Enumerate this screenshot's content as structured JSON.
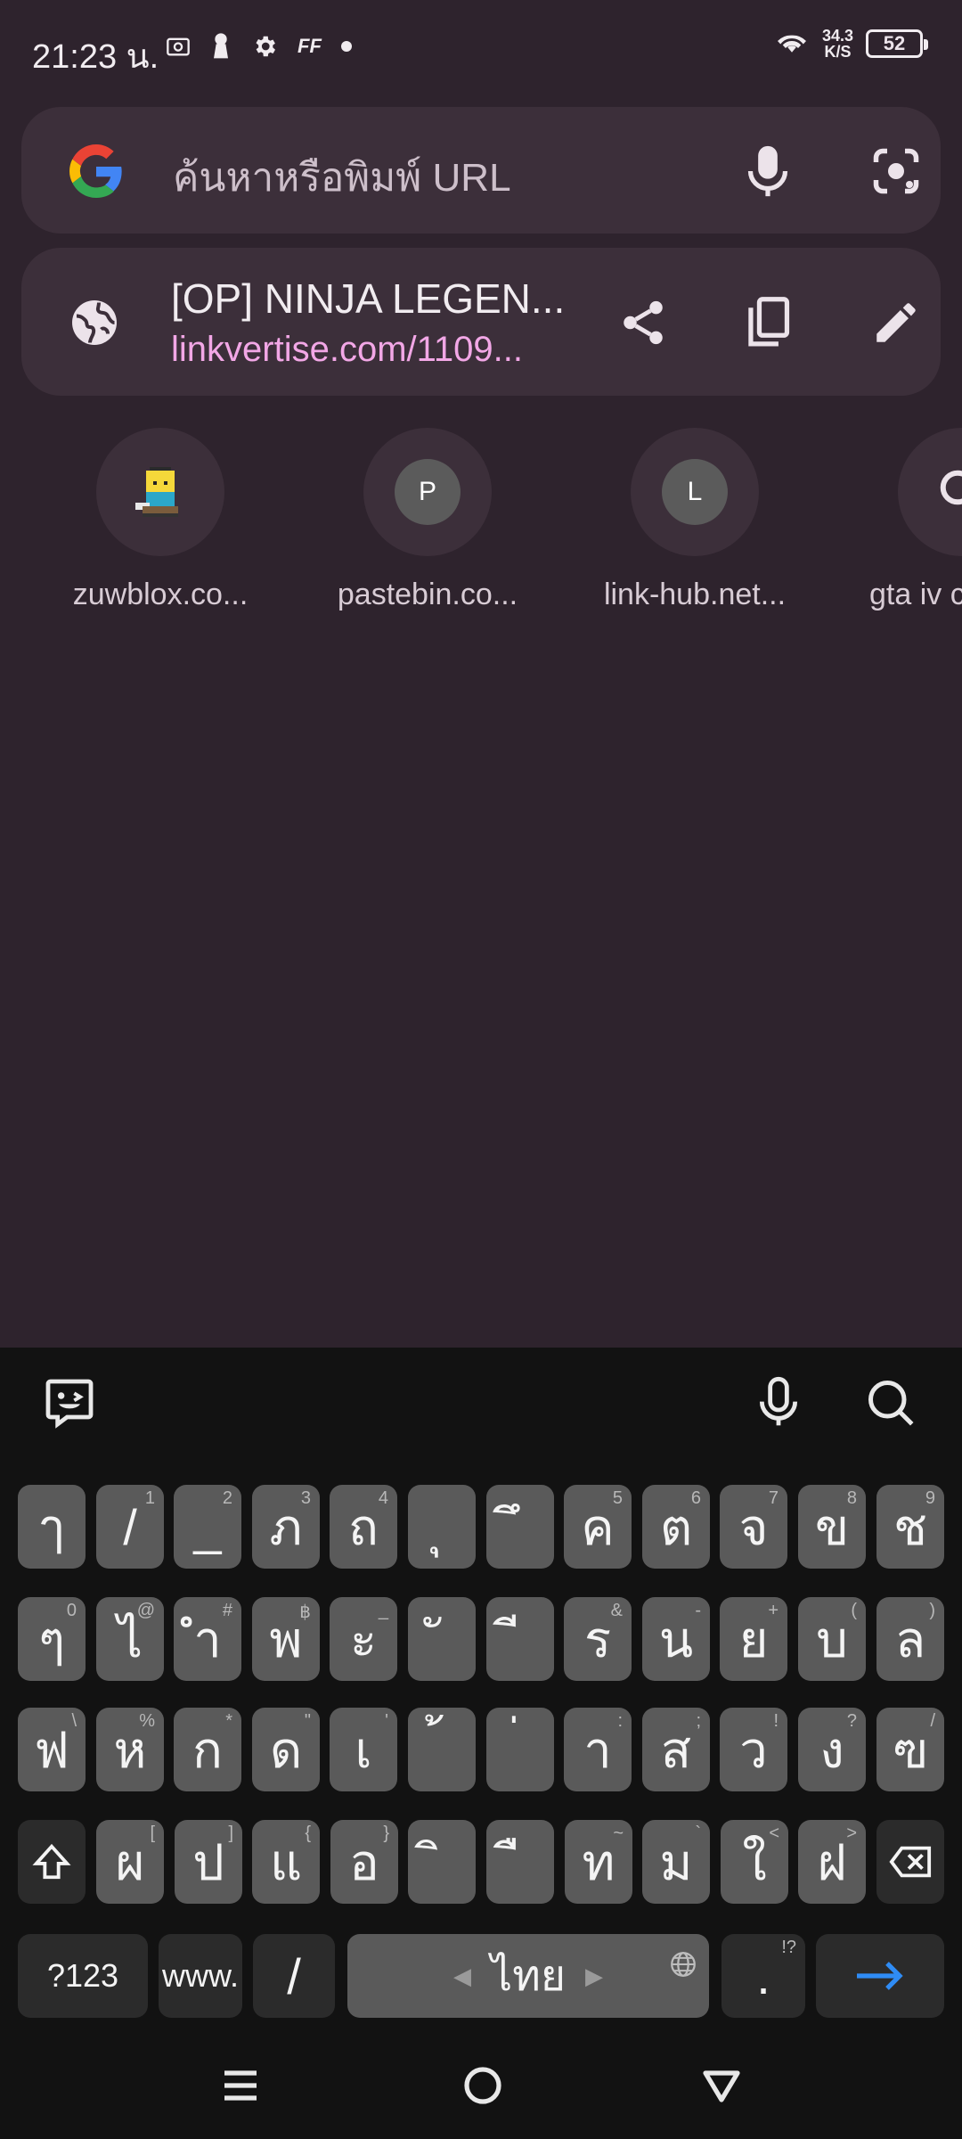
{
  "status_bar": {
    "time": "21:23 น.",
    "net_speed_value": "34.3",
    "net_speed_unit": "K/S",
    "battery": "52",
    "icons": [
      "screenshot-icon",
      "keyhole-icon",
      "gear-icon",
      "ff-icon",
      "dot-icon",
      "wifi-icon"
    ]
  },
  "search": {
    "placeholder": "ค้นหาหรือพิมพ์ URL",
    "icons": [
      "google-logo",
      "microphone-icon",
      "google-lens-icon"
    ]
  },
  "current_page": {
    "title": "[OP] NINJA LEGEN...",
    "url": "linkvertise.com/1109...",
    "icons": [
      "globe-icon",
      "share-icon",
      "copy-icon",
      "edit-icon"
    ]
  },
  "tiles": [
    {
      "label": "zuwblox.co...",
      "letter": "",
      "icon": "pixel-character-favicon"
    },
    {
      "label": "pastebin.co...",
      "letter": "P"
    },
    {
      "label": "link-hub.net...",
      "letter": "L"
    },
    {
      "label": "gta iv c",
      "icon": "search-icon"
    }
  ],
  "keyboard": {
    "toolbar_icons": [
      "emoji-sticker-icon",
      "microphone-icon",
      "search-icon"
    ],
    "row1": [
      {
        "k": "ๅ",
        "h": ""
      },
      {
        "k": "/",
        "h": "1"
      },
      {
        "k": "_",
        "h": "2"
      },
      {
        "k": "ภ",
        "h": "3"
      },
      {
        "k": "ถ",
        "h": "4"
      },
      {
        "k": "ุ",
        "h": ""
      },
      {
        "k": "ึ",
        "h": ""
      },
      {
        "k": "ค",
        "h": "5"
      },
      {
        "k": "ต",
        "h": "6"
      },
      {
        "k": "จ",
        "h": "7"
      },
      {
        "k": "ข",
        "h": "8"
      },
      {
        "k": "ช",
        "h": "9"
      }
    ],
    "row2": [
      {
        "k": "ๆ",
        "h": "0"
      },
      {
        "k": "ไ",
        "h": "@"
      },
      {
        "k": "ำ",
        "h": "#"
      },
      {
        "k": "พ",
        "h": "฿"
      },
      {
        "k": "ะ",
        "h": "_"
      },
      {
        "k": "ั",
        "h": ""
      },
      {
        "k": "ี",
        "h": ""
      },
      {
        "k": "ร",
        "h": "&"
      },
      {
        "k": "น",
        "h": "-"
      },
      {
        "k": "ย",
        "h": "+"
      },
      {
        "k": "บ",
        "h": "("
      },
      {
        "k": "ล",
        "h": ")"
      }
    ],
    "row3": [
      {
        "k": "ฟ",
        "h": "\\"
      },
      {
        "k": "ห",
        "h": "%"
      },
      {
        "k": "ก",
        "h": "*"
      },
      {
        "k": "ด",
        "h": "\""
      },
      {
        "k": "เ",
        "h": "'"
      },
      {
        "k": "้",
        "h": ""
      },
      {
        "k": "่",
        "h": ""
      },
      {
        "k": "า",
        "h": ":"
      },
      {
        "k": "ส",
        "h": ";"
      },
      {
        "k": "ว",
        "h": "!"
      },
      {
        "k": "ง",
        "h": "?"
      },
      {
        "k": "ฃ",
        "h": "/"
      }
    ],
    "row4": [
      {
        "k": "ผ",
        "h": "["
      },
      {
        "k": "ป",
        "h": "]"
      },
      {
        "k": "แ",
        "h": "{"
      },
      {
        "k": "อ",
        "h": "}"
      },
      {
        "k": "ิ",
        "h": ""
      },
      {
        "k": "ื",
        "h": ""
      },
      {
        "k": "ท",
        "h": "~"
      },
      {
        "k": "ม",
        "h": "`"
      },
      {
        "k": "ใ",
        "h": "<"
      },
      {
        "k": "ฝ",
        "h": ">"
      }
    ],
    "sym_key": "?123",
    "www_key": "www.",
    "slash_key": "/",
    "space_label": "ไทย",
    "period_key": ".",
    "period_hint": "!?",
    "enter_icon": "arrow-right-icon",
    "shift_icon": "shift-icon",
    "backspace_icon": "backspace-icon"
  },
  "nav_bar": {
    "icons": [
      "menu-icon",
      "home-icon",
      "back-icon"
    ]
  }
}
